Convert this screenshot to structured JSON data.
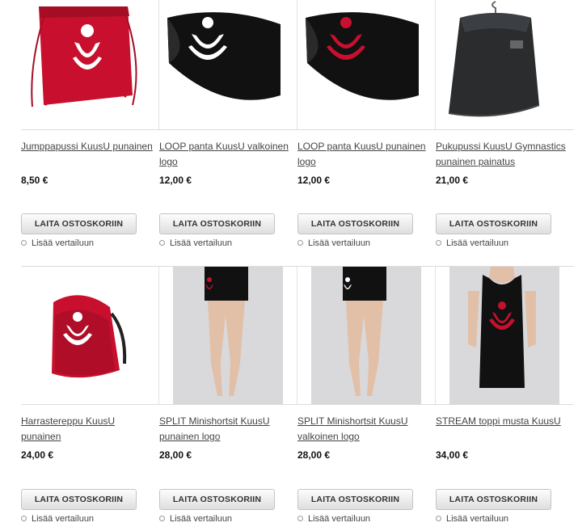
{
  "products": [
    {
      "title": "Jumppapussi KuusU punainen",
      "price": "8,50 €",
      "button": "LAITA OSTOSKORIIN",
      "compare": "Lisää vertailuun",
      "image": "red-drawstring-bag"
    },
    {
      "title": "LOOP panta KuusU valkoinen logo",
      "price": "12,00 €",
      "button": "LAITA OSTOSKORIIN",
      "compare": "Lisää vertailuun",
      "image": "black-headband-white-logo"
    },
    {
      "title": "LOOP panta KuusU punainen logo",
      "price": "12,00 €",
      "button": "LAITA OSTOSKORIIN",
      "compare": "Lisää vertailuun",
      "image": "black-headband-red-logo"
    },
    {
      "title": "Pukupussi KuusU Gymnastics punainen painatus",
      "price": "21,00 €",
      "button": "LAITA OSTOSKORIIN",
      "compare": "Lisää vertailuun",
      "image": "garment-bag"
    },
    {
      "title": "Harrastereppu KuusU punainen",
      "price": "24,00 €",
      "button": "LAITA OSTOSKORIIN",
      "compare": "Lisää vertailuun",
      "image": "red-backpack"
    },
    {
      "title": "SPLIT Minishortsit KuusU punainen logo",
      "price": "28,00 €",
      "button": "LAITA OSTOSKORIIN",
      "compare": "Lisää vertailuun",
      "image": "black-shorts-red-logo"
    },
    {
      "title": "SPLIT Minishortsit KuusU valkoinen logo",
      "price": "28,00 €",
      "button": "LAITA OSTOSKORIIN",
      "compare": "Lisää vertailuun",
      "image": "black-shorts-white-logo"
    },
    {
      "title": "STREAM toppi musta KuusU",
      "price": "34,00 €",
      "button": "LAITA OSTOSKORIIN",
      "compare": "Lisää vertailuun",
      "image": "black-tank-top"
    }
  ],
  "colors": {
    "brand_red": "#c8102e",
    "garment_black": "#111111",
    "photo_bg": "#d9d9dc"
  }
}
